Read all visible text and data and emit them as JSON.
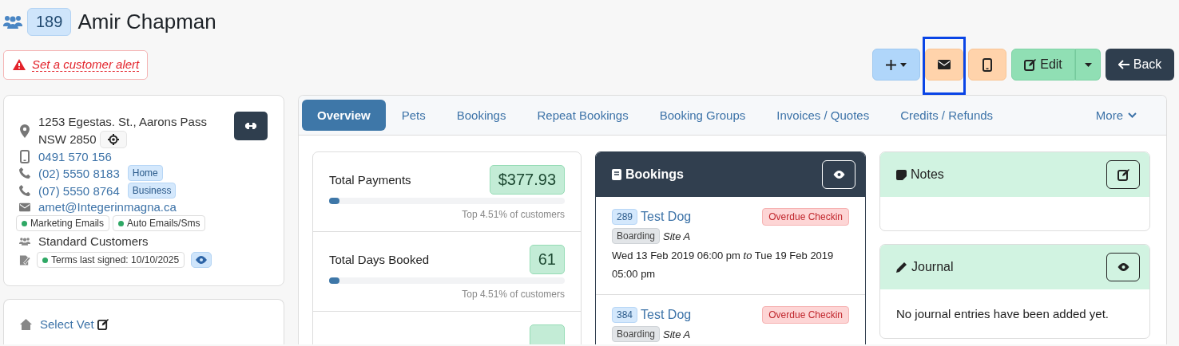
{
  "customer": {
    "count": "189",
    "name": "Amir Chapman"
  },
  "alert": {
    "label": "Set a customer alert"
  },
  "actions": [
    {
      "kind": "add",
      "highlighted": false
    },
    {
      "kind": "email",
      "highlighted": true
    },
    {
      "kind": "sms",
      "highlighted": false
    },
    {
      "kind": "edit",
      "label": "Edit",
      "highlighted": false
    },
    {
      "kind": "back",
      "label": "Back",
      "highlighted": false
    }
  ],
  "contact": {
    "address_lines": [
      "1253 Egestas. St., Aarons Pass",
      "NSW 2850"
    ],
    "mobile": "0491 570 156",
    "phones": [
      {
        "number": "(02) 5550 8183",
        "tag": "Home"
      },
      {
        "number": "(07) 5550 8764",
        "tag": "Business"
      }
    ],
    "email": "amet@Integerinmagna.ca",
    "consents": [
      {
        "label": "Marketing Emails",
        "on": true
      },
      {
        "label": "Auto Emails/Sms",
        "on": true
      }
    ],
    "group": "Standard Customers",
    "terms": {
      "label": "Terms last signed: 10/10/2025",
      "on": true
    }
  },
  "vet": {
    "label": "Select Vet"
  },
  "tabs": [
    {
      "label": "Overview",
      "selected": true
    },
    {
      "label": "Pets",
      "selected": false
    },
    {
      "label": "Bookings",
      "selected": false
    },
    {
      "label": "Repeat Bookings",
      "selected": false
    },
    {
      "label": "Booking Groups",
      "selected": false
    },
    {
      "label": "Invoices / Quotes",
      "selected": false
    },
    {
      "label": "Credits / Refunds",
      "selected": false
    }
  ],
  "more": "More",
  "stats": [
    {
      "label": "Total Payments",
      "value": "$377.93",
      "level": 0.045,
      "note": "Top 4.51% of customers"
    },
    {
      "label": "Total Days Booked",
      "value": "61",
      "level": 0.045,
      "note": "Top 4.51% of customers"
    }
  ],
  "bookings": {
    "title": "Bookings",
    "items": [
      {
        "id": "289",
        "pet": "Test Dog",
        "status": "Overdue Checkin",
        "service": "Boarding",
        "site": "Site A",
        "dates": "Wed 13 Feb 2019 06:00 pm *to* Tue 19 Feb 2019 05:00 pm"
      },
      {
        "id": "384",
        "pet": "Test Dog",
        "status": "Overdue Checkin",
        "service": "Boarding",
        "site": "Site A"
      }
    ]
  },
  "notes": {
    "title": "Notes"
  },
  "journal": {
    "title": "Journal",
    "empty": "No journal entries have been added yet."
  }
}
